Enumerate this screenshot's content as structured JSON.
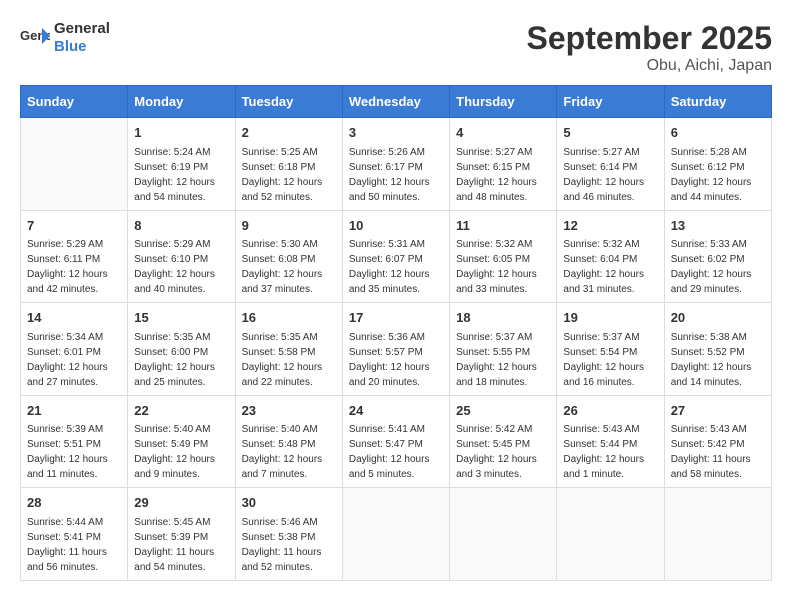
{
  "header": {
    "logo_general": "General",
    "logo_blue": "Blue",
    "month": "September 2025",
    "location": "Obu, Aichi, Japan"
  },
  "weekdays": [
    "Sunday",
    "Monday",
    "Tuesday",
    "Wednesday",
    "Thursday",
    "Friday",
    "Saturday"
  ],
  "weeks": [
    [
      {
        "day": "",
        "info": ""
      },
      {
        "day": "1",
        "info": "Sunrise: 5:24 AM\nSunset: 6:19 PM\nDaylight: 12 hours\nand 54 minutes."
      },
      {
        "day": "2",
        "info": "Sunrise: 5:25 AM\nSunset: 6:18 PM\nDaylight: 12 hours\nand 52 minutes."
      },
      {
        "day": "3",
        "info": "Sunrise: 5:26 AM\nSunset: 6:17 PM\nDaylight: 12 hours\nand 50 minutes."
      },
      {
        "day": "4",
        "info": "Sunrise: 5:27 AM\nSunset: 6:15 PM\nDaylight: 12 hours\nand 48 minutes."
      },
      {
        "day": "5",
        "info": "Sunrise: 5:27 AM\nSunset: 6:14 PM\nDaylight: 12 hours\nand 46 minutes."
      },
      {
        "day": "6",
        "info": "Sunrise: 5:28 AM\nSunset: 6:12 PM\nDaylight: 12 hours\nand 44 minutes."
      }
    ],
    [
      {
        "day": "7",
        "info": "Sunrise: 5:29 AM\nSunset: 6:11 PM\nDaylight: 12 hours\nand 42 minutes."
      },
      {
        "day": "8",
        "info": "Sunrise: 5:29 AM\nSunset: 6:10 PM\nDaylight: 12 hours\nand 40 minutes."
      },
      {
        "day": "9",
        "info": "Sunrise: 5:30 AM\nSunset: 6:08 PM\nDaylight: 12 hours\nand 37 minutes."
      },
      {
        "day": "10",
        "info": "Sunrise: 5:31 AM\nSunset: 6:07 PM\nDaylight: 12 hours\nand 35 minutes."
      },
      {
        "day": "11",
        "info": "Sunrise: 5:32 AM\nSunset: 6:05 PM\nDaylight: 12 hours\nand 33 minutes."
      },
      {
        "day": "12",
        "info": "Sunrise: 5:32 AM\nSunset: 6:04 PM\nDaylight: 12 hours\nand 31 minutes."
      },
      {
        "day": "13",
        "info": "Sunrise: 5:33 AM\nSunset: 6:02 PM\nDaylight: 12 hours\nand 29 minutes."
      }
    ],
    [
      {
        "day": "14",
        "info": "Sunrise: 5:34 AM\nSunset: 6:01 PM\nDaylight: 12 hours\nand 27 minutes."
      },
      {
        "day": "15",
        "info": "Sunrise: 5:35 AM\nSunset: 6:00 PM\nDaylight: 12 hours\nand 25 minutes."
      },
      {
        "day": "16",
        "info": "Sunrise: 5:35 AM\nSunset: 5:58 PM\nDaylight: 12 hours\nand 22 minutes."
      },
      {
        "day": "17",
        "info": "Sunrise: 5:36 AM\nSunset: 5:57 PM\nDaylight: 12 hours\nand 20 minutes."
      },
      {
        "day": "18",
        "info": "Sunrise: 5:37 AM\nSunset: 5:55 PM\nDaylight: 12 hours\nand 18 minutes."
      },
      {
        "day": "19",
        "info": "Sunrise: 5:37 AM\nSunset: 5:54 PM\nDaylight: 12 hours\nand 16 minutes."
      },
      {
        "day": "20",
        "info": "Sunrise: 5:38 AM\nSunset: 5:52 PM\nDaylight: 12 hours\nand 14 minutes."
      }
    ],
    [
      {
        "day": "21",
        "info": "Sunrise: 5:39 AM\nSunset: 5:51 PM\nDaylight: 12 hours\nand 11 minutes."
      },
      {
        "day": "22",
        "info": "Sunrise: 5:40 AM\nSunset: 5:49 PM\nDaylight: 12 hours\nand 9 minutes."
      },
      {
        "day": "23",
        "info": "Sunrise: 5:40 AM\nSunset: 5:48 PM\nDaylight: 12 hours\nand 7 minutes."
      },
      {
        "day": "24",
        "info": "Sunrise: 5:41 AM\nSunset: 5:47 PM\nDaylight: 12 hours\nand 5 minutes."
      },
      {
        "day": "25",
        "info": "Sunrise: 5:42 AM\nSunset: 5:45 PM\nDaylight: 12 hours\nand 3 minutes."
      },
      {
        "day": "26",
        "info": "Sunrise: 5:43 AM\nSunset: 5:44 PM\nDaylight: 12 hours\nand 1 minute."
      },
      {
        "day": "27",
        "info": "Sunrise: 5:43 AM\nSunset: 5:42 PM\nDaylight: 11 hours\nand 58 minutes."
      }
    ],
    [
      {
        "day": "28",
        "info": "Sunrise: 5:44 AM\nSunset: 5:41 PM\nDaylight: 11 hours\nand 56 minutes."
      },
      {
        "day": "29",
        "info": "Sunrise: 5:45 AM\nSunset: 5:39 PM\nDaylight: 11 hours\nand 54 minutes."
      },
      {
        "day": "30",
        "info": "Sunrise: 5:46 AM\nSunset: 5:38 PM\nDaylight: 11 hours\nand 52 minutes."
      },
      {
        "day": "",
        "info": ""
      },
      {
        "day": "",
        "info": ""
      },
      {
        "day": "",
        "info": ""
      },
      {
        "day": "",
        "info": ""
      }
    ]
  ]
}
